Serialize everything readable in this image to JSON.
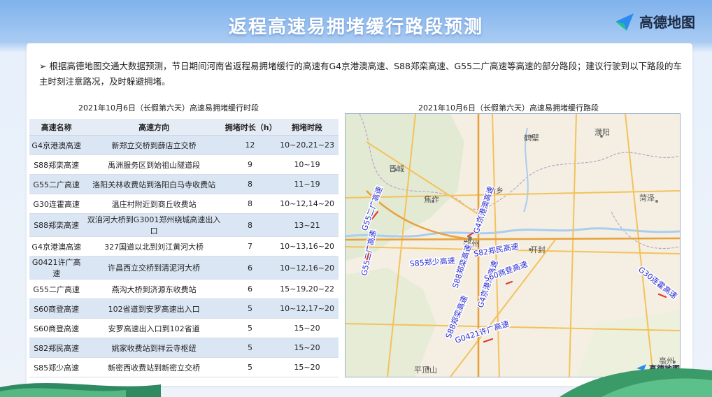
{
  "header": {
    "title": "返程高速易拥堵缓行路段预测",
    "logo_text": "高德地图"
  },
  "intro": {
    "bullet": "➢",
    "text": "根据高德地图交通大数据预测，节日期间河南省返程易拥堵缓行的高速有G4京港澳高速、S88郑栾高速、G55二广高速等高速的部分路段；建议行驶到以下路段的车主时刻注意路况，及时躲避拥堵。"
  },
  "table": {
    "caption": "2021年10月6日（长假第六天）高速易拥堵缓行时段",
    "headers": [
      "高速名称",
      "高速方向",
      "拥堵时长（h）",
      "拥堵时段"
    ],
    "rows": [
      [
        "G4京港澳高速",
        "新郑立交桥到薛店立交桥",
        "12",
        "10~20,21~23"
      ],
      [
        "S88郑栾高速",
        "禹洲服务区到始祖山隧道段",
        "9",
        "10~19"
      ],
      [
        "G55二广高速",
        "洛阳关林收费站到洛阳白马寺收费站",
        "8",
        "11~19"
      ],
      [
        "G30连霍高速",
        "温庄村附近到商丘收费站",
        "8",
        "10~12,14~20"
      ],
      [
        "S88郑栾高速",
        "双洎河大桥到G3001郑州绕城高速出入口",
        "8",
        "13~21"
      ],
      [
        "G4京港澳高速",
        "327国道以北到刘江黄河大桥",
        "7",
        "10~13,16~20"
      ],
      [
        "G0421许广高速",
        "许昌西立交桥到清泥河大桥",
        "6",
        "10~12,16~20"
      ],
      [
        "G55二广高速",
        "燕沟大桥到济源东收费站",
        "6",
        "15~19,20~22"
      ],
      [
        "S60商登高速",
        "102省道到安罗高速出入口",
        "5",
        "10~12,17~20"
      ],
      [
        "S60商登高速",
        "安罗高速出入口到102省道",
        "5",
        "15~20"
      ],
      [
        "S82郑民高速",
        "姚家收费站到祥云寺枢纽",
        "5",
        "15~20"
      ],
      [
        "S85郑少高速",
        "新密西收费站到新密立交桥",
        "5",
        "15~20"
      ]
    ]
  },
  "map": {
    "caption": "2021年10月6日（长假第六天）高速易拥堵缓行路段",
    "watermark": "高德地图",
    "places": {
      "hebi": "鹤壁",
      "puyang": "濮阳",
      "jincheng": "晋城",
      "xinxiang": "新乡",
      "jiaozuo": "焦作",
      "heze": "菏泽",
      "zhengzhou": "郑州",
      "kaifeng": "开封",
      "pingdingshan": "平顶山",
      "bozhou": "亳州"
    },
    "road_labels": {
      "g55_a": "G55二广高速",
      "g55_b": "G55二广高速",
      "g4_a": "G4京港澳高速",
      "s82": "S82郑民高速",
      "s85": "S85郑少高速",
      "s88_a": "S88郑栾高速",
      "g4_b": "G4京港澳高速",
      "s60": "S60商登高速",
      "s88_b": "S88郑栾高速",
      "g0421": "G0421许广高速",
      "g30": "G30连霍高速"
    }
  }
}
